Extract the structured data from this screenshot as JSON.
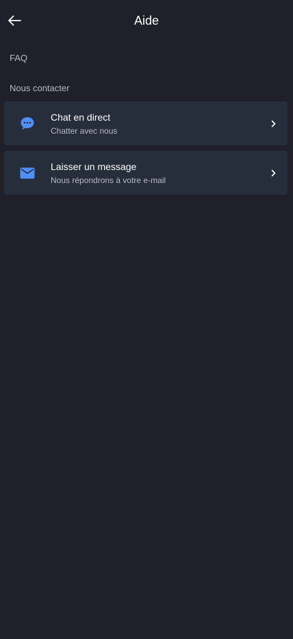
{
  "header": {
    "title": "Aide",
    "back_icon": "arrow-left-icon"
  },
  "faq": {
    "label": "FAQ"
  },
  "contact": {
    "section_label": "Nous contacter",
    "items": [
      {
        "title": "Chat en direct",
        "subtitle": "Chatter avec nous",
        "icon": "chat-bubble-icon",
        "icon_color": "#4f8ff7"
      },
      {
        "title": "Laisser un message",
        "subtitle": "Nous répondrons à votre e-mail",
        "icon": "mail-icon",
        "icon_color": "#4f8ff7"
      }
    ]
  },
  "colors": {
    "background": "#1f2029",
    "card": "#262d3b",
    "accent": "#4f8ff7",
    "muted_text": "#b7bac3"
  }
}
